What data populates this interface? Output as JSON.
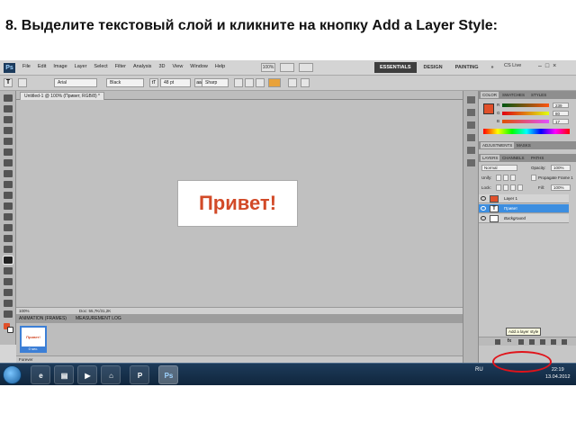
{
  "heading": "8. Выделите текстовый слой и кликните на кнопку Add a Layer Style:",
  "menu": {
    "logo": "Ps",
    "items": [
      "File",
      "Edit",
      "Image",
      "Layer",
      "Select",
      "Filter",
      "Analysis",
      "3D",
      "View",
      "Window",
      "Help"
    ],
    "zoom_box": "100%",
    "workspaces": [
      "ESSENTIALS",
      "DESIGN",
      "PAINTING"
    ],
    "more": "»",
    "cs_live": "CS Live",
    "window_controls": [
      "–",
      "□",
      "×"
    ]
  },
  "options_bar": {
    "tool_icon": "T",
    "font_family": "Arial",
    "font_style": "Black",
    "font_size_icon": "tT",
    "font_size": "48 pt",
    "aa_icon": "aa",
    "antialias": "Sharp",
    "text_color": "#e8a23a"
  },
  "document": {
    "tab": "Untitled-1 @ 100% (Привет, RGB/8) *",
    "text": "Привет!",
    "text_color": "#d24a28",
    "status_zoom": "100%",
    "status_doc": "Doc: 55,7K/31,2K"
  },
  "animation": {
    "tabs": [
      "ANIMATION (FRAMES)",
      "MEASUREMENT LOG"
    ],
    "frame_thumb_text": "Привет!",
    "frame_time": "0 sec.",
    "loop": "Forever"
  },
  "color_panel": {
    "tabs": [
      "COLOR",
      "SWATCHES",
      "STYLES"
    ],
    "r_label": "R",
    "r": "239",
    "g_label": "G",
    "g": "80",
    "b_label": "B",
    "b": "17",
    "foreground": "#e0502a"
  },
  "adjust_tabs": [
    "ADJUSTMENTS",
    "MASKS"
  ],
  "layers_panel": {
    "tabs": [
      "LAYERS",
      "CHANNELS",
      "PATHS"
    ],
    "blend_mode": "Normal",
    "opacity_label": "Opacity:",
    "opacity": "100%",
    "unify_label": "Unify:",
    "propagate_label": "Propagate Frame 1",
    "lock_label": "Lock:",
    "fill_label": "Fill:",
    "fill": "100%",
    "layers": [
      {
        "name": "Layer 1"
      },
      {
        "name": "Привет"
      },
      {
        "name": "Background"
      }
    ],
    "fx_label": "fx",
    "tooltip": "Add a layer style"
  },
  "taskbar": {
    "apps": [
      "e",
      "▤",
      "▶",
      "⌂",
      "P",
      "Ps"
    ],
    "lang": "RU",
    "time": "22:19",
    "date": "13.04.2012"
  }
}
